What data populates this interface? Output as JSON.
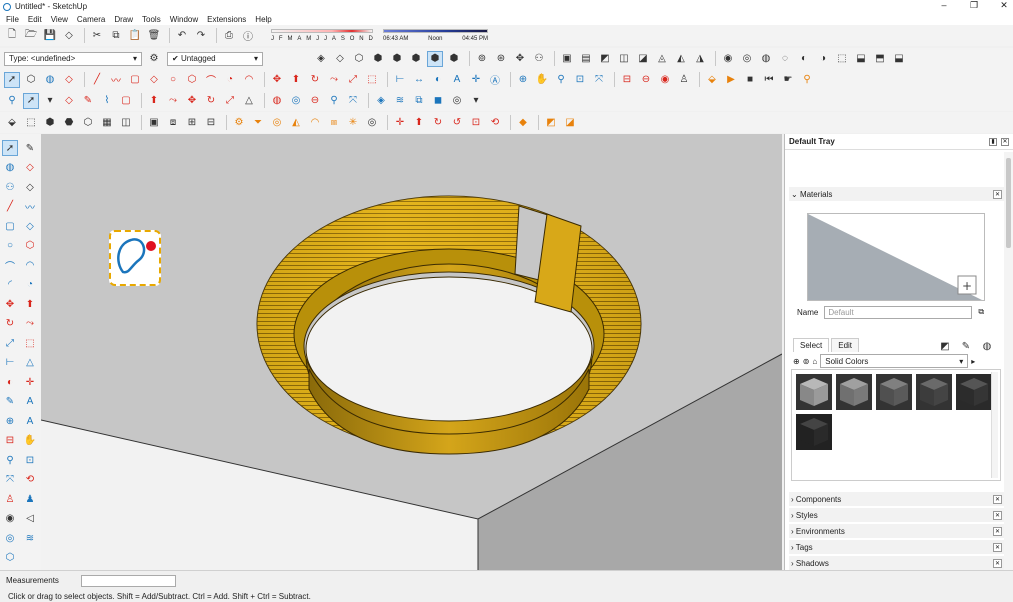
{
  "window": {
    "title": "Untitled* - SketchUp",
    "minimize": "–",
    "maximize": "❐",
    "close": "✕"
  },
  "menu": [
    "File",
    "Edit",
    "View",
    "Camera",
    "Draw",
    "Tools",
    "Window",
    "Extensions",
    "Help"
  ],
  "shadow_timeline": {
    "months": [
      "J",
      "F",
      "M",
      "A",
      "M",
      "J",
      "J",
      "A",
      "S",
      "O",
      "N",
      "D"
    ],
    "times": [
      "06:43 AM",
      "Noon",
      "04:45 PM"
    ]
  },
  "type_dropdown": "Type: <undefined>",
  "tag_dropdown": "Untagged",
  "tray": {
    "title": "Default Tray",
    "materials_section": "Materials",
    "name_label": "Name",
    "name_placeholder": "Default",
    "tab_select": "Select",
    "tab_edit": "Edit",
    "library": "Solid Colors",
    "swatch_colors": [
      "#9a9a9a",
      "#7a7a7a",
      "#5a5a5a",
      "#444444",
      "#353535",
      "#2a2a2a"
    ],
    "sections": [
      "Components",
      "Styles",
      "Environments",
      "Tags",
      "Shadows"
    ]
  },
  "status": {
    "measurements_label": "Measurements",
    "hint": "Click or drag to select objects. Shift = Add/Subtract. Ctrl = Add. Shift + Ctrl = Subtract."
  },
  "colors": {
    "ring_gold": "#e8b820",
    "ring_dark": "#9a7408",
    "sky": "#c6c6c6",
    "ground": "#f0f0f0"
  }
}
